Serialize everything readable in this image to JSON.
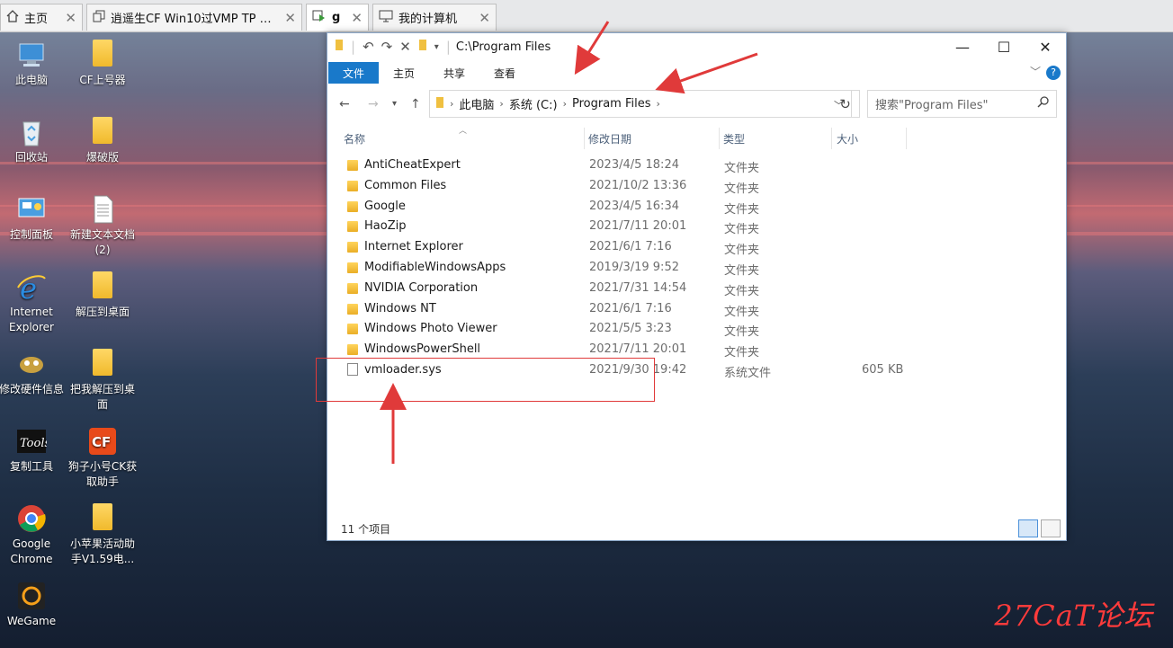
{
  "vm_tabs": [
    {
      "label": "主页",
      "icon": "home-icon"
    },
    {
      "label": "逍遥生CF Win10过VMP TP HP ...",
      "icon": "copy-window-icon"
    },
    {
      "label": "g",
      "icon": "vm-play-icon"
    },
    {
      "label": "我的计算机",
      "icon": "monitor-icon"
    }
  ],
  "desktop_icons": [
    {
      "label": "此电脑",
      "icon": "computer-icon"
    },
    {
      "label": "CF上号器",
      "icon": "folder-icon"
    },
    {
      "label": "回收站",
      "icon": "recycle-bin-icon"
    },
    {
      "label": "爆破版",
      "icon": "folder-icon"
    },
    {
      "label": "控制面板",
      "icon": "control-panel-icon"
    },
    {
      "label": "新建文本文档 (2)",
      "icon": "text-document-icon"
    },
    {
      "label": "Internet Explorer",
      "icon": "internet-explorer-icon"
    },
    {
      "label": "解压到桌面",
      "icon": "folder-icon"
    },
    {
      "label": "修改硬件信息",
      "icon": "hardware-tool-icon"
    },
    {
      "label": "把我解压到桌面",
      "icon": "folder-icon"
    },
    {
      "label": "复制工具",
      "icon": "tools-icon"
    },
    {
      "label": "狗子小号CK获取助手",
      "icon": "crossfire-icon"
    },
    {
      "label": "Google Chrome",
      "icon": "chrome-icon"
    },
    {
      "label": "小苹果活动助手V1.59电...",
      "icon": "folder-icon"
    },
    {
      "label": "WeGame",
      "icon": "wegame-icon"
    }
  ],
  "explorer": {
    "title": "C:\\Program Files",
    "ribbon_tabs": [
      "文件",
      "主页",
      "共享",
      "查看"
    ],
    "breadcrumb": [
      "此电脑",
      "系统 (C:)",
      "Program Files"
    ],
    "search_placeholder": "搜索\"Program Files\"",
    "columns": {
      "name": "名称",
      "date": "修改日期",
      "type": "类型",
      "size": "大小"
    },
    "files": [
      {
        "name": "AntiCheatExpert",
        "date": "2023/4/5 18:24",
        "type": "文件夹",
        "size": ""
      },
      {
        "name": "Common Files",
        "date": "2021/10/2 13:36",
        "type": "文件夹",
        "size": ""
      },
      {
        "name": "Google",
        "date": "2023/4/5 16:34",
        "type": "文件夹",
        "size": ""
      },
      {
        "name": "HaoZip",
        "date": "2021/7/11 20:01",
        "type": "文件夹",
        "size": ""
      },
      {
        "name": "Internet Explorer",
        "date": "2021/6/1 7:16",
        "type": "文件夹",
        "size": ""
      },
      {
        "name": "ModifiableWindowsApps",
        "date": "2019/3/19 9:52",
        "type": "文件夹",
        "size": ""
      },
      {
        "name": "NVIDIA Corporation",
        "date": "2021/7/31 14:54",
        "type": "文件夹",
        "size": ""
      },
      {
        "name": "Windows NT",
        "date": "2021/6/1 7:16",
        "type": "文件夹",
        "size": ""
      },
      {
        "name": "Windows Photo Viewer",
        "date": "2021/5/5 3:23",
        "type": "文件夹",
        "size": ""
      },
      {
        "name": "WindowsPowerShell",
        "date": "2021/7/11 20:01",
        "type": "文件夹",
        "size": ""
      },
      {
        "name": "vmloader.sys",
        "date": "2021/9/30 19:42",
        "type": "系统文件",
        "size": "605 KB"
      }
    ],
    "status": "11 个项目"
  },
  "watermark": "27CaT论坛",
  "colors": {
    "accent": "#1979ca",
    "annotation": "#e03a3a"
  }
}
